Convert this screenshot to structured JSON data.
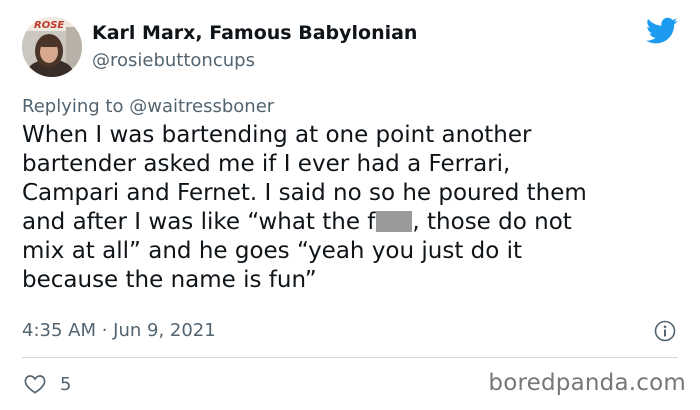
{
  "user": {
    "display_name": "Karl Marx, Famous Babylonian",
    "handle": "@rosiebuttoncups",
    "avatar_sign_text": "ROSE"
  },
  "reply": {
    "prefix": "Replying to",
    "mention": "@waitressboner"
  },
  "tweet": {
    "line1": "When I was bartending at one point another",
    "line2": "bartender asked me if I ever had a Ferrari,",
    "line3": "Campari and Fernet. I said no so he poured them",
    "line4_before": "and after I was like “what the f",
    "line4_after": ", those do not",
    "line5": "mix at all” and he goes “yeah you just do it",
    "line6": "because the name is fun”"
  },
  "meta": {
    "timestamp": "4:35 AM · Jun 9, 2021"
  },
  "engagement": {
    "likes": "5"
  },
  "watermark": "boredpanda.com",
  "colors": {
    "twitter_blue": "#1d9bf0",
    "muted_text": "#536471",
    "censor_bar": "#9a9a9a"
  },
  "icons": [
    "twitter-bird-icon",
    "info-icon",
    "heart-icon"
  ]
}
